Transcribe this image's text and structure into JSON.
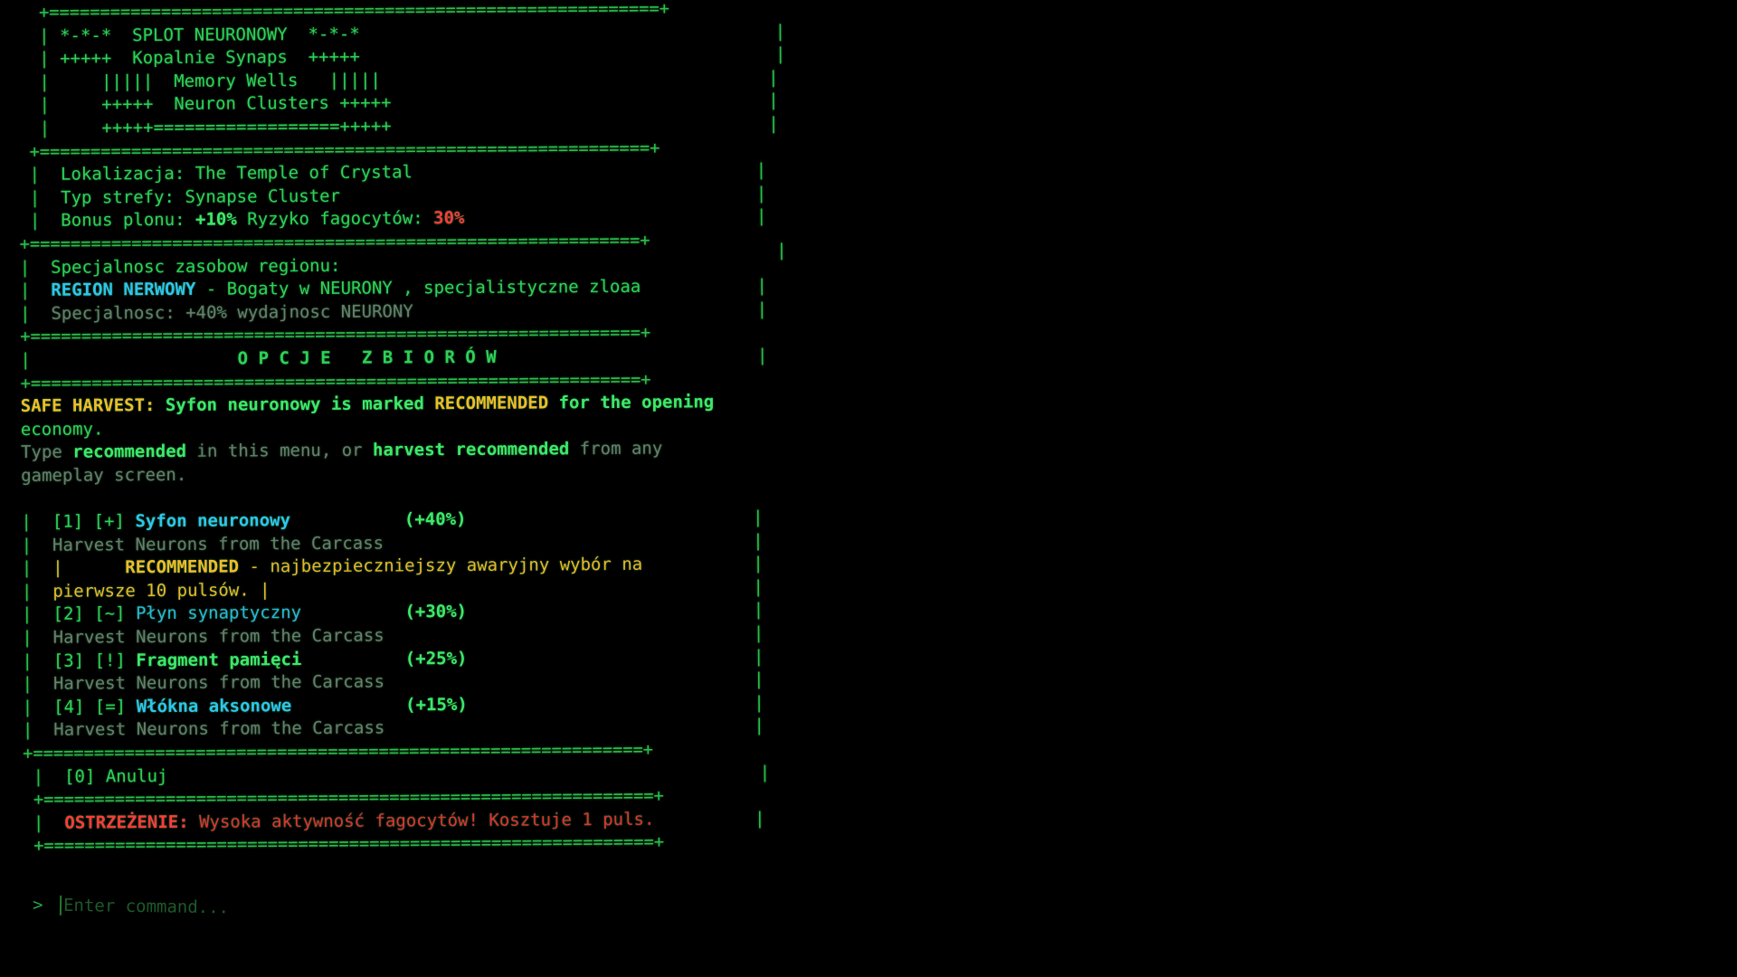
{
  "colors": {
    "background": "#000000",
    "terminal_green": "#2ed158",
    "highlight_cyan": "#29b6e0",
    "recommended_yellow": "#ecb429",
    "warning_red": "#e33131",
    "muted_gray": "#6f7a72"
  },
  "rule": "+============================================================+",
  "bar": "|",
  "banner": {
    "line1": "*-*-*  SPLOT NEURONOWY  *-*-*",
    "line2": "+++++  Kopalnie Synaps  +++++",
    "line3": "     |||||  Memory Wells   |||||",
    "line4": "     +++++  Neuron Clusters +++++",
    "line5": "     +++++==================+++++"
  },
  "location": {
    "label": "Lokalizacja:",
    "value": "The Temple of Crystal",
    "zone_label": "Typ strefy:",
    "zone_value": "Synapse Cluster",
    "bonus_label": "Bonus plonu:",
    "bonus_value": "+10%",
    "risk_label": "Ryzyko fagocytów:",
    "risk_value": "30%"
  },
  "specialty": {
    "heading": "Specjalnosc zasobow regionu:",
    "region_name": "REGION NERWOWY",
    "region_desc": " - Bogaty w NEURONY , specjalistyczne zloaa",
    "efficiency": "Specjalnosc: +40% wydajnosc NEURONY"
  },
  "options_title": "O P C J E   Z B I O R Ó W",
  "safe_harvest": {
    "label": "SAFE HARVEST:",
    "text1": " Syfon neuronowy is marked ",
    "recommended": "RECOMMENDED",
    "text2": " for the opening",
    "text3": "economy.",
    "type_word": "Type ",
    "cmd1": "recommended",
    "mid": " in this menu, or ",
    "cmd2": "harvest recommended",
    "end": " from any",
    "end2": "gameplay screen."
  },
  "options": [
    {
      "key": "[1]",
      "marker": "[+]",
      "name": "Syfon neuronowy",
      "bonus": "(+40%)",
      "desc": "Harvest Neurons from the Carcass",
      "note_prefix": "|      ",
      "note_label": "RECOMMENDED",
      "note_text": " - najbezpieczniejszy awaryjny wybór na",
      "note_text2": "pierwsze 10 pulsów. |"
    },
    {
      "key": "[2]",
      "marker": "[~]",
      "name": "Płyn synaptyczny",
      "bonus": "(+30%)",
      "desc": "Harvest Neurons from the Carcass"
    },
    {
      "key": "[3]",
      "marker": "[!]",
      "name": "Fragment pamięci",
      "bonus": "(+25%)",
      "desc": "Harvest Neurons from the Carcass"
    },
    {
      "key": "[4]",
      "marker": "[=]",
      "name": "Włókna aksonowe",
      "bonus": "(+15%)",
      "desc": "Harvest Neurons from the Carcass"
    }
  ],
  "cancel": {
    "label": "[0] Anuluj"
  },
  "warning": {
    "label": "OSTRZEŻENIE:",
    "text": " Wysoka aktywność fagocytów! Kosztuje 1 puls."
  },
  "prompt": {
    "symbol": ">",
    "placeholder": "Enter command..."
  }
}
